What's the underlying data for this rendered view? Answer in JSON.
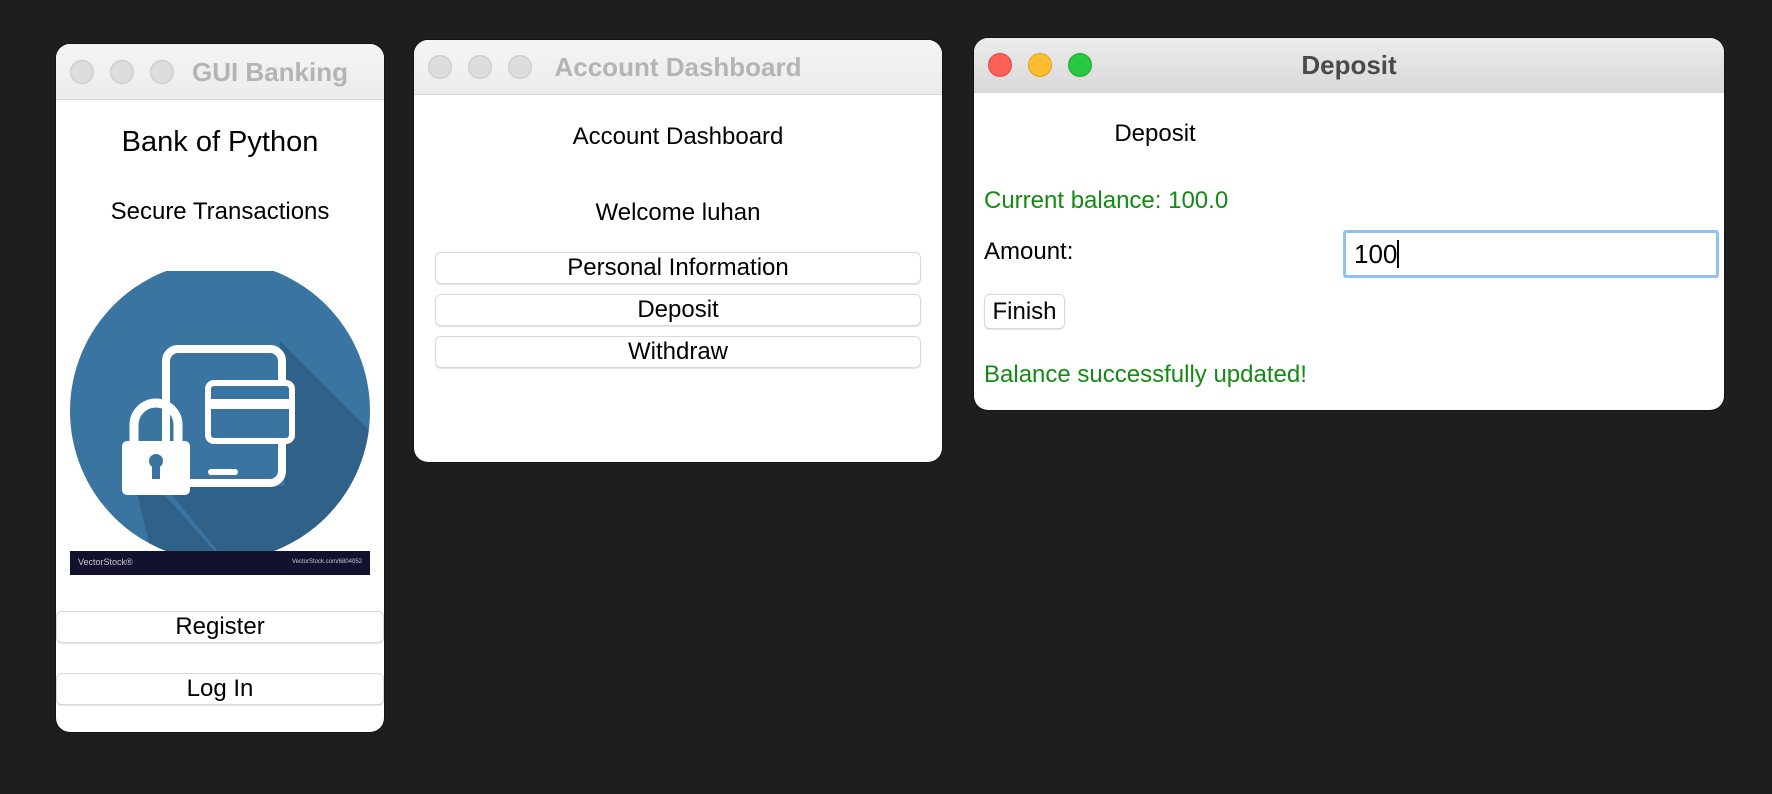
{
  "colors": {
    "desktop_background": "#1e1e1e",
    "success_green": "#138a13",
    "logo_blue": "#3a74a0",
    "logo_banner": "#12122e",
    "focus_ring": "#8fc0f0"
  },
  "login_window": {
    "title": "GUI Banking",
    "bank_name": "Bank of Python",
    "tagline": "Secure Transactions",
    "logo": {
      "icon": "tablet-lock-card-icon",
      "watermark_left": "VectorStock®",
      "watermark_right": "VectorStock.com/6804052"
    },
    "register_label": "Register",
    "login_label": "Log In"
  },
  "dashboard_window": {
    "title": "Account Dashboard",
    "heading": "Account Dashboard",
    "welcome": "Welcome luhan",
    "buttons": {
      "personal_info": "Personal Information",
      "deposit": "Deposit",
      "withdraw": "Withdraw"
    }
  },
  "deposit_window": {
    "title": "Deposit",
    "heading": "Deposit",
    "current_balance": "Current balance: 100.0",
    "amount_label": "Amount:",
    "amount_value": "100",
    "finish_label": "Finish",
    "status_message": "Balance successfully updated!"
  }
}
